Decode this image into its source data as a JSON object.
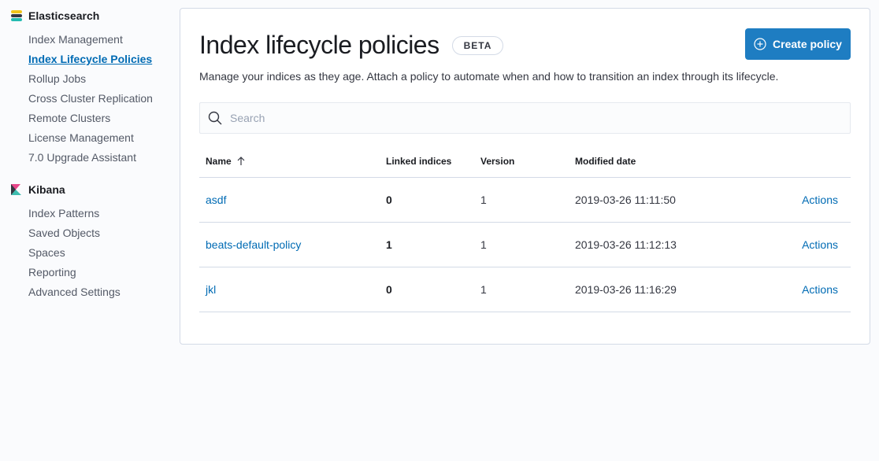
{
  "sidebar": {
    "elasticsearch": {
      "title": "Elasticsearch",
      "items": [
        {
          "label": "Index Management"
        },
        {
          "label": "Index Lifecycle Policies",
          "active": true
        },
        {
          "label": "Rollup Jobs"
        },
        {
          "label": "Cross Cluster Replication"
        },
        {
          "label": "Remote Clusters"
        },
        {
          "label": "License Management"
        },
        {
          "label": "7.0 Upgrade Assistant"
        }
      ]
    },
    "kibana": {
      "title": "Kibana",
      "items": [
        {
          "label": "Index Patterns"
        },
        {
          "label": "Saved Objects"
        },
        {
          "label": "Spaces"
        },
        {
          "label": "Reporting"
        },
        {
          "label": "Advanced Settings"
        }
      ]
    }
  },
  "main": {
    "title": "Index lifecycle policies",
    "badge": "BETA",
    "create_button": "Create policy",
    "description": "Manage your indices as they age. Attach a policy to automate when and how to transition an index through its lifecycle.",
    "search_placeholder": "Search",
    "table": {
      "headers": {
        "name": "Name",
        "linked": "Linked indices",
        "version": "Version",
        "modified": "Modified date"
      },
      "rows": [
        {
          "name": "asdf",
          "linked": "0",
          "version": "1",
          "modified": "2019-03-26 11:11:50",
          "actions": "Actions"
        },
        {
          "name": "beats-default-policy",
          "linked": "1",
          "version": "1",
          "modified": "2019-03-26 11:12:13",
          "actions": "Actions"
        },
        {
          "name": "jkl",
          "linked": "0",
          "version": "1",
          "modified": "2019-03-26 11:16:29",
          "actions": "Actions"
        }
      ]
    }
  },
  "colors": {
    "accent": "#006bb4",
    "button": "#1e7dc2"
  }
}
